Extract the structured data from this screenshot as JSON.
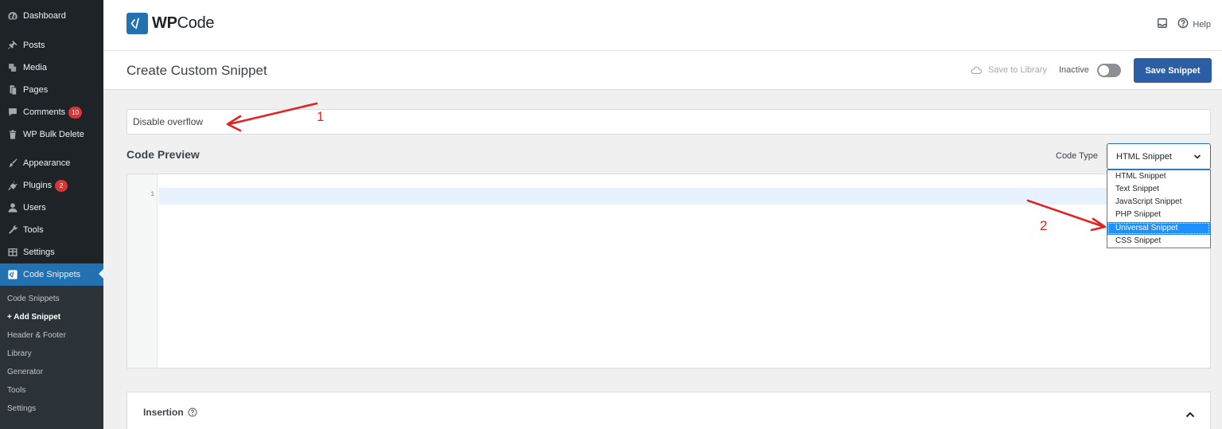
{
  "sidebar": {
    "items": [
      {
        "label": "Dashboard",
        "icon": "dashboard-icon"
      },
      {
        "label": "Posts",
        "icon": "pin-icon"
      },
      {
        "label": "Media",
        "icon": "media-icon"
      },
      {
        "label": "Pages",
        "icon": "pages-icon"
      },
      {
        "label": "Comments",
        "icon": "comment-icon",
        "badge": "10"
      },
      {
        "label": "WP Bulk Delete",
        "icon": "trash-icon"
      },
      {
        "label": "Appearance",
        "icon": "brush-icon"
      },
      {
        "label": "Plugins",
        "icon": "plug-icon",
        "badge": "2"
      },
      {
        "label": "Users",
        "icon": "user-icon"
      },
      {
        "label": "Tools",
        "icon": "wrench-icon"
      },
      {
        "label": "Settings",
        "icon": "settings-icon"
      },
      {
        "label": "Code Snippets",
        "icon": "code-icon",
        "active": true
      }
    ],
    "submenu": [
      {
        "label": "Code Snippets"
      },
      {
        "label": "+ Add Snippet",
        "current": true
      },
      {
        "label": "Header & Footer"
      },
      {
        "label": "Library"
      },
      {
        "label": "Generator"
      },
      {
        "label": "Tools"
      },
      {
        "label": "Settings"
      }
    ]
  },
  "topbar": {
    "logo_bold": "WP",
    "logo_rest": "Code",
    "help_label": "Help"
  },
  "header": {
    "title": "Create Custom Snippet",
    "save_to_library": "Save to Library",
    "status_label": "Inactive",
    "status_active": false,
    "save_button": "Save Snippet"
  },
  "snippet": {
    "title_value": "Disable overflow"
  },
  "code_preview": {
    "label": "Code Preview",
    "code_type_label": "Code Type",
    "selected_type": "HTML Snippet",
    "line_numbers": [
      "1"
    ]
  },
  "code_type_options": [
    {
      "label": "HTML Snippet"
    },
    {
      "label": "Text Snippet"
    },
    {
      "label": "JavaScript Snippet"
    },
    {
      "label": "PHP Snippet"
    },
    {
      "label": "Universal Snippet",
      "highlighted": true
    },
    {
      "label": "CSS Snippet"
    }
  ],
  "insertion": {
    "label": "Insertion"
  },
  "annotations": {
    "step1": "1",
    "step2": "2"
  },
  "colors": {
    "sidebar_bg": "#1d2327",
    "active_menu": "#2271b1",
    "primary_button": "#2c5ea6",
    "highlight_option": "#1e90ff",
    "annotation_red": "#e02424"
  }
}
